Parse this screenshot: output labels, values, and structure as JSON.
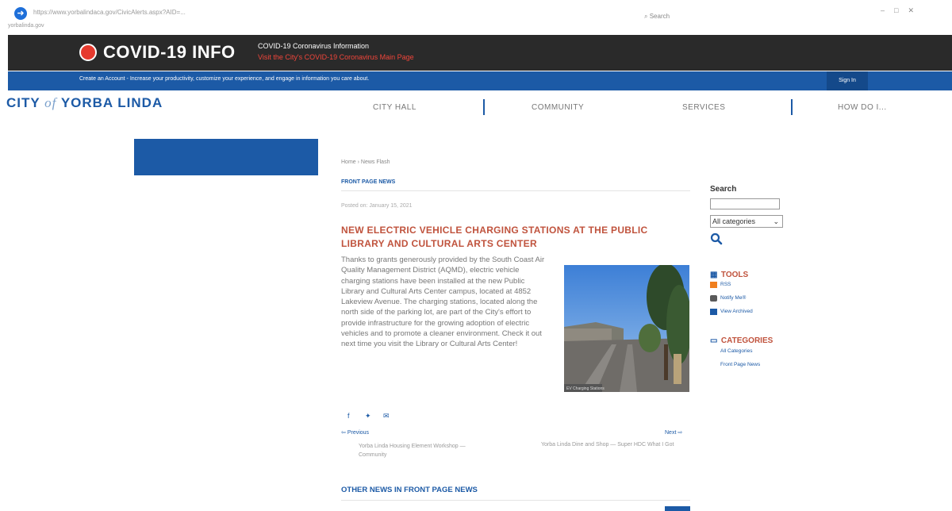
{
  "browser": {
    "address": "https://www.yorbalindaca.gov/CivicAlerts.aspx?AID=...",
    "tab": "yorbalinda.gov",
    "search_placeholder": "Search",
    "nav_icon": "arrow-right-icon"
  },
  "covid": {
    "title": "COVID-19 INFO",
    "line1": "COVID-19 Coronavirus Information",
    "line2": "Visit the City's COVID-19 Coronavirus Main Page"
  },
  "account_bar": {
    "text": "Create an Account - Increase your productivity, customize your experience, and engage in information you care about.",
    "sign_in": "Sign In"
  },
  "site": {
    "logo_city": "CITY",
    "logo_of": "of",
    "logo_name": "YORBA LINDA"
  },
  "nav": [
    "CITY HALL",
    "COMMUNITY",
    "SERVICES",
    "HOW DO I..."
  ],
  "article": {
    "breadcrumb": "Home › News Flash",
    "category": "FRONT PAGE NEWS",
    "posted": "Posted on: January 15, 2021",
    "headline": "NEW ELECTRIC VEHICLE CHARGING STATIONS AT THE PUBLIC LIBRARY AND CULTURAL ARTS CENTER",
    "body": "Thanks to grants generously provided by the South Coast Air Quality Management District (AQMD), electric vehicle charging stations have been installed at the new Public Library and Cultural Arts Center campus, located at 4852 Lakeview Avenue. The charging stations, located along the north side of the parking lot, are part of the City's effort to provide infrastructure for the growing adoption of electric vehicles and to promote a cleaner environment. Check it out next time you visit the Library or Cultural Arts Center!",
    "photo_caption": "EV Charging Stations",
    "previous_label": "Previous",
    "next_label": "Next",
    "previous_title": "Yorba Linda Housing Element Workshop — Community",
    "next_title": "Yorba Linda Dine and Shop — Super HDC What I Got",
    "other_news": "OTHER NEWS IN FRONT PAGE NEWS"
  },
  "sidebar": {
    "search_title": "Search",
    "select_value": "All categories",
    "tools_title": "TOOLS",
    "tools": [
      "RSS",
      "Notify Me®",
      "View Archived"
    ],
    "categories_title": "CATEGORIES",
    "categories": [
      "All Categories",
      "Front Page News"
    ]
  },
  "colors": {
    "brand_blue": "#1c5aa6",
    "headline_red": "#c0533d",
    "banner_dark": "#2a2a2a",
    "covid_red": "#e63a2e"
  }
}
